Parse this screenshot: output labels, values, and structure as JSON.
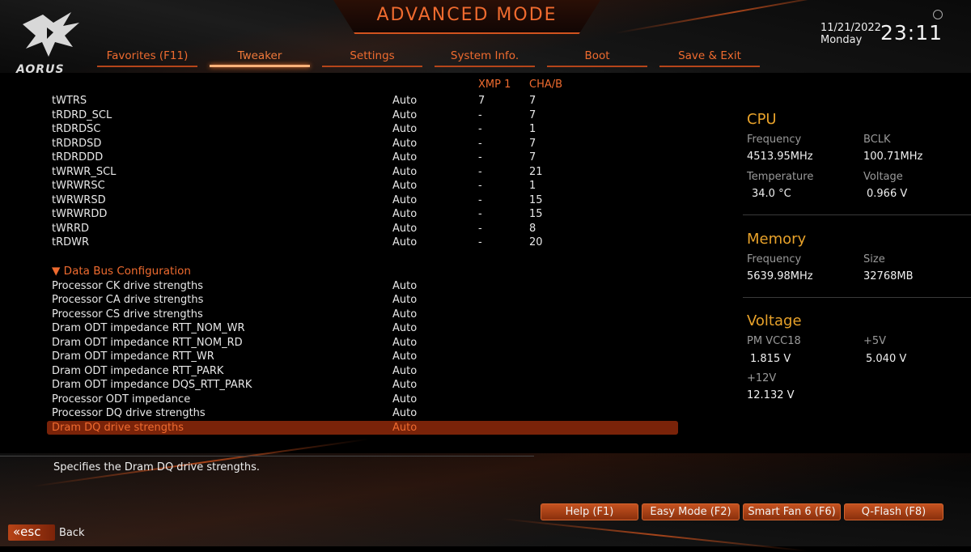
{
  "header": {
    "title": "ADVANCED MODE",
    "logo_text": "AORUS",
    "date": "11/21/2022",
    "day": "Monday",
    "time": "23:11"
  },
  "tabs": [
    {
      "label": "Favorites (F11)"
    },
    {
      "label": "Tweaker"
    },
    {
      "label": "Settings"
    },
    {
      "label": "System Info."
    },
    {
      "label": "Boot"
    },
    {
      "label": "Save & Exit"
    }
  ],
  "columns": {
    "xmp": "XMP 1",
    "cha": "CHA/B"
  },
  "timings": [
    {
      "name": "tWTRS",
      "value": "Auto",
      "xmp": "7",
      "cha": "7"
    },
    {
      "name": "tRDRD_SCL",
      "value": "Auto",
      "xmp": "-",
      "cha": "7"
    },
    {
      "name": "tRDRDSC",
      "value": "Auto",
      "xmp": "-",
      "cha": "1"
    },
    {
      "name": "tRDRDSD",
      "value": "Auto",
      "xmp": "-",
      "cha": "7"
    },
    {
      "name": "tRDRDDD",
      "value": "Auto",
      "xmp": "-",
      "cha": "7"
    },
    {
      "name": "tWRWR_SCL",
      "value": "Auto",
      "xmp": "-",
      "cha": "21"
    },
    {
      "name": "tWRWRSC",
      "value": "Auto",
      "xmp": "-",
      "cha": "1"
    },
    {
      "name": "tWRWRSD",
      "value": "Auto",
      "xmp": "-",
      "cha": "15"
    },
    {
      "name": "tWRWRDD",
      "value": "Auto",
      "xmp": "-",
      "cha": "15"
    },
    {
      "name": "tWRRD",
      "value": "Auto",
      "xmp": "-",
      "cha": "8"
    },
    {
      "name": "tRDWR",
      "value": "Auto",
      "xmp": "-",
      "cha": "20"
    }
  ],
  "section": {
    "label": "▼ Data Bus Configuration"
  },
  "databus": [
    {
      "name": "Processor CK drive strengths",
      "value": "Auto"
    },
    {
      "name": "Processor CA drive strengths",
      "value": "Auto"
    },
    {
      "name": "Processor CS drive strengths",
      "value": "Auto"
    },
    {
      "name": "Dram ODT impedance RTT_NOM_WR",
      "value": "Auto"
    },
    {
      "name": "Dram ODT impedance RTT_NOM_RD",
      "value": "Auto"
    },
    {
      "name": "Dram ODT impedance RTT_WR",
      "value": "Auto"
    },
    {
      "name": "Dram ODT impedance RTT_PARK",
      "value": "Auto"
    },
    {
      "name": "Dram ODT impedance DQS_RTT_PARK",
      "value": "Auto"
    },
    {
      "name": "Processor ODT impedance",
      "value": "Auto"
    },
    {
      "name": "Processor DQ drive strengths",
      "value": "Auto"
    },
    {
      "name": "Dram DQ drive strengths",
      "value": "Auto"
    }
  ],
  "help_text": "Specifies the Dram DQ drive strengths.",
  "panel": {
    "cpu": {
      "title": "CPU",
      "freq_label": "Frequency",
      "freq": "4513.95MHz",
      "bclk_label": "BCLK",
      "bclk": "100.71MHz",
      "temp_label": "Temperature",
      "temp": "34.0 °C",
      "volt_label": "Voltage",
      "volt": "0.966 V"
    },
    "memory": {
      "title": "Memory",
      "freq_label": "Frequency",
      "freq": "5639.98MHz",
      "size_label": "Size",
      "size": "32768MB"
    },
    "voltage": {
      "title": "Voltage",
      "pm_label": "PM VCC18",
      "pm": "1.815 V",
      "v5_label": "+5V",
      "v5": "5.040 V",
      "v12_label": "+12V",
      "v12": "12.132 V"
    }
  },
  "footer": {
    "buttons": [
      {
        "label": "Help (F1)"
      },
      {
        "label": "Easy Mode (F2)"
      },
      {
        "label": "Smart Fan 6 (F6)"
      },
      {
        "label": "Q-Flash (F8)"
      }
    ],
    "esc_label": "«esc",
    "back_label": "Back"
  },
  "colors": {
    "accent": "#ef6b2f",
    "panel_heading": "#e8a22a",
    "selected_row": "#7a2309"
  },
  "icons": {
    "logo": "aorus-eagle-logo",
    "settings": "gear-icon"
  }
}
